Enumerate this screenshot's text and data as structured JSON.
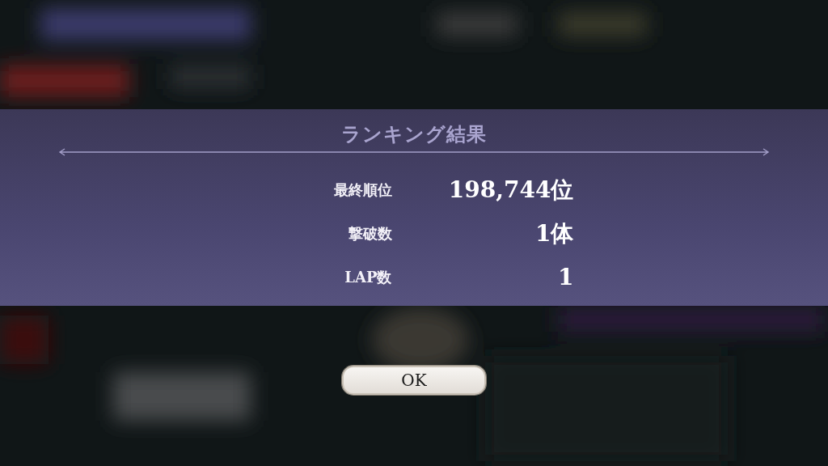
{
  "dialog": {
    "title": "ランキング結果",
    "rows": [
      {
        "label": "最終順位",
        "value": "198,744位"
      },
      {
        "label": "撃破数",
        "value": "1体"
      },
      {
        "label": "LAP数",
        "value": "1"
      }
    ]
  },
  "buttons": [
    {
      "label": "OK"
    }
  ]
}
